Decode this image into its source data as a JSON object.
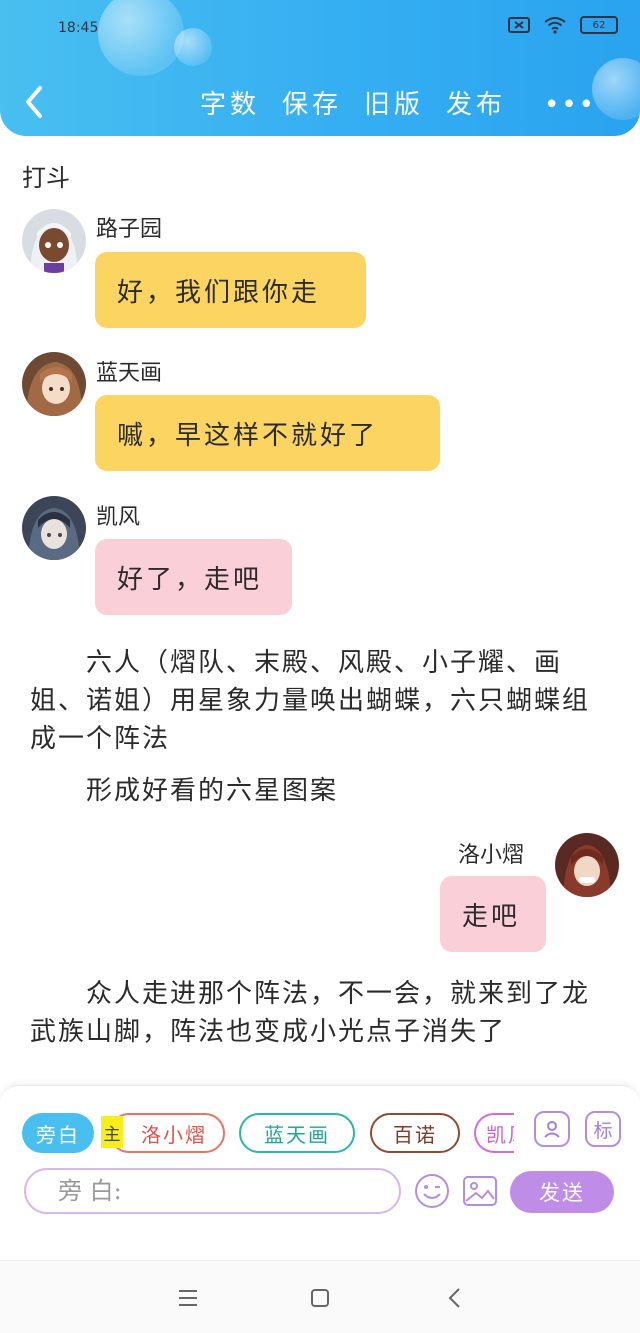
{
  "status_bar": {
    "time": "18:45",
    "battery_level": "62",
    "icons": [
      "sim-off-icon",
      "wifi-icon",
      "battery-icon"
    ]
  },
  "header": {
    "back_icon": "chevron-left-icon",
    "actions": [
      "字数",
      "保存",
      "旧版",
      "发布"
    ],
    "more_label": "•••",
    "colors": {
      "gradient_start": "#49bff0",
      "gradient_end": "#2aa3f0"
    }
  },
  "chapter_title": "打斗",
  "messages": [
    {
      "speaker": "路子园",
      "text": "好，我们跟你走",
      "bubble_color": "#fcd462",
      "avatar_color": "#b7c3cc"
    },
    {
      "speaker": "蓝天画",
      "text": "嘁，早这样不就好了",
      "bubble_color": "#fcd462",
      "avatar_color": "#9a6a4a"
    },
    {
      "speaker": "凯风",
      "text": "好了，走吧",
      "bubble_color": "#fbcfd8",
      "avatar_color": "#4a5a70"
    },
    {
      "speaker": "洛小熠",
      "text": "走吧",
      "bubble_color": "#fbcfd8",
      "avatar_color": "#7a3426"
    }
  ],
  "narrations": [
    "　　六人（熠队、末殿、风殿、小子耀、画姐、诺姐）用星象力量唤出蝴蝶，六只蝴蝶组成一个阵法",
    "　　形成好看的六星图案",
    "　　众人走进那个阵法，不一会，就来到了龙武族山脚，阵法也变成小光点子消失了"
  ],
  "input_panel": {
    "chips": {
      "narration": "旁白",
      "main_tag": "主",
      "luo": "洛小熠",
      "lan": "蓝天画",
      "bai": "百诺",
      "kai": "凯风"
    },
    "icons": [
      "role-card-icon",
      "tag-icon",
      "emoji-icon",
      "image-icon"
    ],
    "tag_label": "标",
    "input_placeholder": "旁 白:",
    "send_label": "发送",
    "send_color": "#bf8ce8"
  },
  "nav_bar": {
    "icons": [
      "menu-icon",
      "home-square-icon",
      "back-triangle-icon"
    ]
  }
}
